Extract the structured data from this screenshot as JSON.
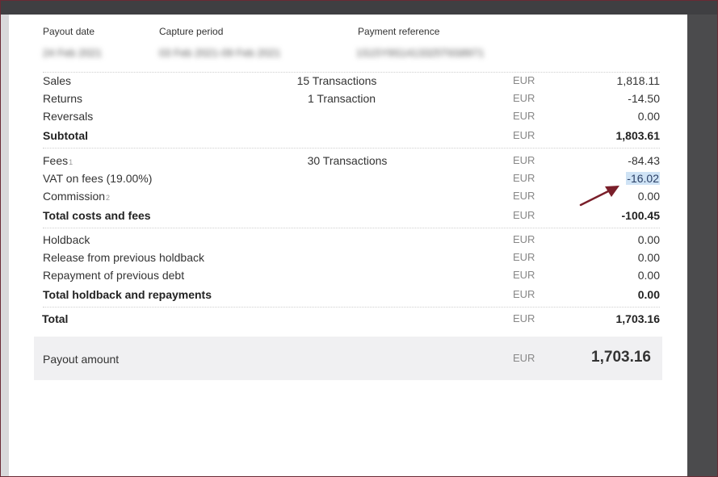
{
  "header": {
    "labels": {
      "payout_date": "Payout date",
      "capture_period": "Capture period",
      "payment_reference": "Payment reference"
    },
    "values": {
      "payout_date": "24 Feb 2021",
      "capture_period": "03 Feb 2021-09 Feb 2021",
      "payment_reference": "1S15Y9S1413325T6S8971"
    }
  },
  "sections": {
    "sales": {
      "rows": [
        {
          "label": "Sales",
          "transactions": "15 Transactions",
          "currency": "EUR",
          "amount": "1,818.11"
        },
        {
          "label": "Returns",
          "transactions": "1 Transaction",
          "currency": "EUR",
          "amount": "-14.50"
        },
        {
          "label": "Reversals",
          "transactions": "",
          "currency": "EUR",
          "amount": "0.00"
        }
      ],
      "total": {
        "label": "Subtotal",
        "currency": "EUR",
        "amount": "1,803.61"
      }
    },
    "costs": {
      "rows": [
        {
          "label": "Fees",
          "footnote": "1",
          "transactions": "30 Transactions",
          "currency": "EUR",
          "amount": "-84.43"
        },
        {
          "label": "VAT on fees (19.00%)",
          "transactions": "",
          "currency": "EUR",
          "amount": "-16.02"
        },
        {
          "label": "Commission",
          "footnote": "2",
          "transactions": "",
          "currency": "EUR",
          "amount": "0.00"
        }
      ],
      "total": {
        "label": "Total costs and fees",
        "currency": "EUR",
        "amount": "-100.45"
      }
    },
    "holdback": {
      "rows": [
        {
          "label": "Holdback",
          "currency": "EUR",
          "amount": "0.00"
        },
        {
          "label": "Release from previous holdback",
          "currency": "EUR",
          "amount": "0.00"
        },
        {
          "label": "Repayment of previous debt",
          "currency": "EUR",
          "amount": "0.00"
        }
      ],
      "total": {
        "label": "Total holdback and repayments",
        "currency": "EUR",
        "amount": "0.00"
      }
    }
  },
  "total": {
    "label": "Total",
    "currency": "EUR",
    "amount": "1,703.16"
  },
  "payout": {
    "label": "Payout amount",
    "currency": "EUR",
    "amount": "1,703.16"
  },
  "annotation": {
    "arrow_color": "#7a1f2a",
    "highlight_color": "#cfe3f5"
  }
}
